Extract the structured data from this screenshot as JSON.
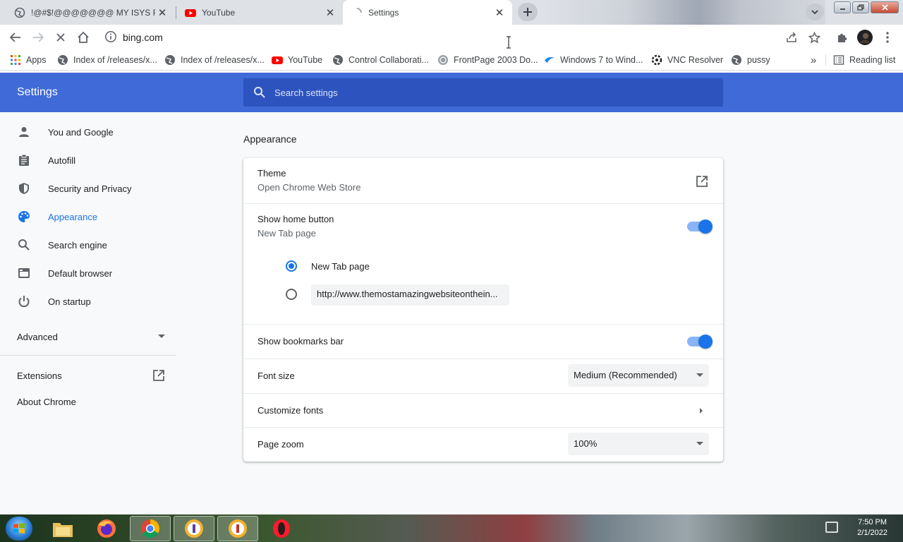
{
  "browser": {
    "tabs": [
      {
        "title": "!@#$!@@@@@@@ MY ISYS PF",
        "active": false
      },
      {
        "title": "YouTube",
        "active": false
      },
      {
        "title": "Settings",
        "active": true
      }
    ],
    "url": "bing.com",
    "bookmarks": [
      {
        "label": "Apps",
        "icon": "apps-grid-icon"
      },
      {
        "label": "Index of /releases/x...",
        "icon": "globe-icon"
      },
      {
        "label": "Index of /releases/x...",
        "icon": "globe-icon"
      },
      {
        "label": "YouTube",
        "icon": "youtube-icon"
      },
      {
        "label": "Control Collaborati...",
        "icon": "globe-icon"
      },
      {
        "label": "FrontPage 2003 Do...",
        "icon": "frontpage-icon"
      },
      {
        "label": "Windows 7 to Wind...",
        "icon": "windows-icon"
      },
      {
        "label": "VNC Resolver",
        "icon": "vnc-icon"
      },
      {
        "label": "pussy",
        "icon": "globe-icon"
      }
    ],
    "overflow_label": "»",
    "reading_list": "Reading list"
  },
  "settings": {
    "title": "Settings",
    "search_placeholder": "Search settings",
    "nav": [
      {
        "label": "You and Google",
        "icon": "person-icon"
      },
      {
        "label": "Autofill",
        "icon": "clipboard-icon"
      },
      {
        "label": "Security and Privacy",
        "icon": "shield-icon"
      },
      {
        "label": "Appearance",
        "icon": "palette-icon"
      },
      {
        "label": "Search engine",
        "icon": "search-icon"
      },
      {
        "label": "Default browser",
        "icon": "browser-icon"
      },
      {
        "label": "On startup",
        "icon": "power-icon"
      }
    ],
    "advanced": "Advanced",
    "extensions": "Extensions",
    "about": "About Chrome",
    "appearance": {
      "section_title": "Appearance",
      "theme_label": "Theme",
      "theme_sub": "Open Chrome Web Store",
      "home_label": "Show home button",
      "home_sub": "New Tab page",
      "home_enabled": true,
      "radio_newtab": "New Tab page",
      "radio_custom_url": "http://www.themostamazingwebsiteonthein...",
      "bookmarks_label": "Show bookmarks bar",
      "bookmarks_enabled": true,
      "font_size_label": "Font size",
      "font_size_value": "Medium (Recommended)",
      "customize_fonts_label": "Customize fonts",
      "page_zoom_label": "Page zoom",
      "page_zoom_value": "100%"
    }
  },
  "taskbar": {
    "time": "7:50 PM",
    "date": "2/1/2022"
  }
}
